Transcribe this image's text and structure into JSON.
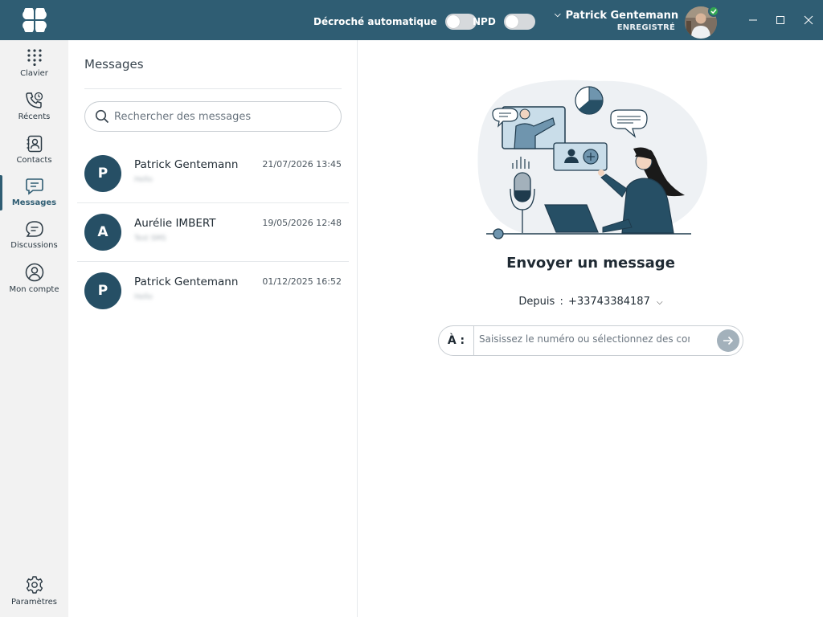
{
  "app": {
    "brand_color": "#2f5d73",
    "logo_icon": "four-leaf-logo"
  },
  "header": {
    "auto_answer_label": "Décroché automatique",
    "auto_answer_on": false,
    "dnd_label": "NPD",
    "dnd_on": false,
    "user_name": "Patrick Gentemann",
    "user_status": "ENREGISTRÉ",
    "presence_color": "#33a852"
  },
  "window_controls": [
    "minimize-icon",
    "maximize-icon",
    "close-icon"
  ],
  "nav": {
    "items": [
      {
        "label": "Clavier",
        "icon": "dialpad-icon"
      },
      {
        "label": "Récents",
        "icon": "recent-calls-icon"
      },
      {
        "label": "Contacts",
        "icon": "contacts-icon"
      },
      {
        "label": "Messages",
        "icon": "messages-icon",
        "active": true
      },
      {
        "label": "Discussions",
        "icon": "discussions-icon"
      },
      {
        "label": "Mon compte",
        "icon": "account-icon"
      }
    ],
    "settings_label": "Paramètres"
  },
  "messages_panel": {
    "title": "Messages",
    "search_placeholder": "Rechercher des messages",
    "conversations": [
      {
        "initial": "P",
        "name": "Patrick Gentemann",
        "date": "21/07/2026 13:45",
        "preview": "Hello"
      },
      {
        "initial": "A",
        "name": "Aurélie IMBERT",
        "date": "19/05/2026 12:48",
        "preview": "Test SMS"
      },
      {
        "initial": "P",
        "name": "Patrick Gentemann",
        "date": "01/12/2025 16:52",
        "preview": "Hello"
      }
    ]
  },
  "compose": {
    "title": "Envoyer un message",
    "from_label": "Depuis",
    "from_separator": ":",
    "from_number": "+33743384187",
    "to_label": "À :",
    "to_placeholder": "Saisissez le numéro ou sélectionnez des contacts"
  }
}
